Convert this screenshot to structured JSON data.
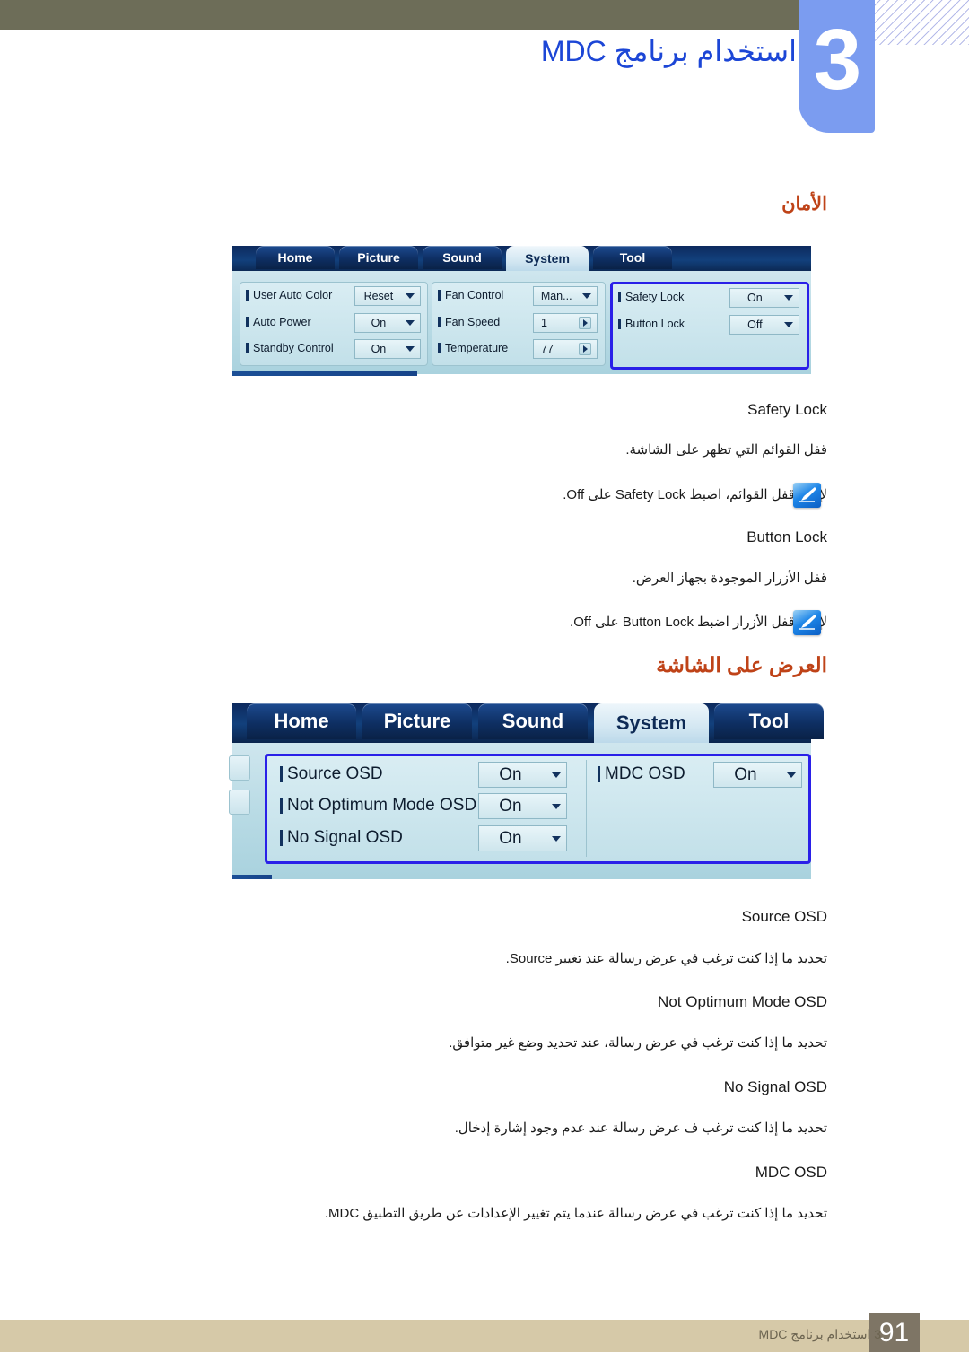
{
  "header": {
    "chapter_number": "3",
    "title": "استخدام برنامج MDC"
  },
  "sections": [
    {
      "heading": "الأمان"
    },
    {
      "heading": "العرض على الشاشة"
    }
  ],
  "screenshot_security": {
    "tabs": [
      {
        "label": "Home",
        "active": false
      },
      {
        "label": "Picture",
        "active": false
      },
      {
        "label": "Sound",
        "active": false
      },
      {
        "label": "System",
        "active": true
      },
      {
        "label": "Tool",
        "active": false
      }
    ],
    "group_left": [
      {
        "label": "User Auto Color",
        "value": "Reset",
        "control": "dropdown"
      },
      {
        "label": "Auto Power",
        "value": "On",
        "control": "dropdown"
      },
      {
        "label": "Standby Control",
        "value": "On",
        "control": "dropdown"
      }
    ],
    "group_middle": [
      {
        "label": "Fan Control",
        "value": "Man...",
        "control": "dropdown"
      },
      {
        "label": "Fan Speed",
        "value": "1",
        "control": "spinner"
      },
      {
        "label": "Temperature",
        "value": "77",
        "control": "spinner"
      }
    ],
    "group_right": [
      {
        "label": "Safety Lock",
        "value": "On",
        "control": "dropdown"
      },
      {
        "label": "Button Lock",
        "value": "Off",
        "control": "dropdown"
      }
    ],
    "highlight_color": "#2a20e8"
  },
  "screenshot_osd": {
    "tabs": [
      {
        "label": "Home",
        "active": false
      },
      {
        "label": "Picture",
        "active": false
      },
      {
        "label": "Sound",
        "active": false
      },
      {
        "label": "System",
        "active": true
      },
      {
        "label": "Tool",
        "active": false
      }
    ],
    "group_left": [
      {
        "label": "Source OSD",
        "value": "On",
        "control": "dropdown"
      },
      {
        "label": "Not Optimum Mode OSD",
        "value": "On",
        "control": "dropdown"
      },
      {
        "label": "No Signal OSD",
        "value": "On",
        "control": "dropdown"
      }
    ],
    "group_right": [
      {
        "label": "MDC OSD",
        "value": "On",
        "control": "dropdown"
      }
    ],
    "highlight_color": "#2a20e8"
  },
  "entries": [
    {
      "term": "Safety Lock",
      "desc": "قفل القوائم التي تظهر على الشاشة.",
      "note": "لإلغاء قفل القوائم، اضبط Safety Lock على Off."
    },
    {
      "term": "Button Lock",
      "desc": "قفل الأزرار الموجودة بجهاز العرض.",
      "note": "لإلغاء قفل الأزرار اضبط Button Lock على Off."
    },
    {
      "term": "Source OSD",
      "desc": "تحديد ما إذا كنت ترغب في عرض رسالة عند تغيير Source."
    },
    {
      "term": "Not Optimum Mode OSD",
      "desc": "تحديد ما إذا كنت ترغب في عرض رسالة، عند تحديد وضع غير متوافق."
    },
    {
      "term": "No Signal OSD",
      "desc": "تحديد ما إذا كنت ترغب ف عرض رسالة عند عدم وجود إشارة إدخال."
    },
    {
      "term": "MDC OSD",
      "desc": "تحديد ما إذا كنت ترغب في عرض رسالة عندما يتم تغيير الإعدادات عن طريق التطبيق MDC."
    }
  ],
  "footer": {
    "page_number": "91",
    "text": "3 استخدام برنامج MDC"
  }
}
